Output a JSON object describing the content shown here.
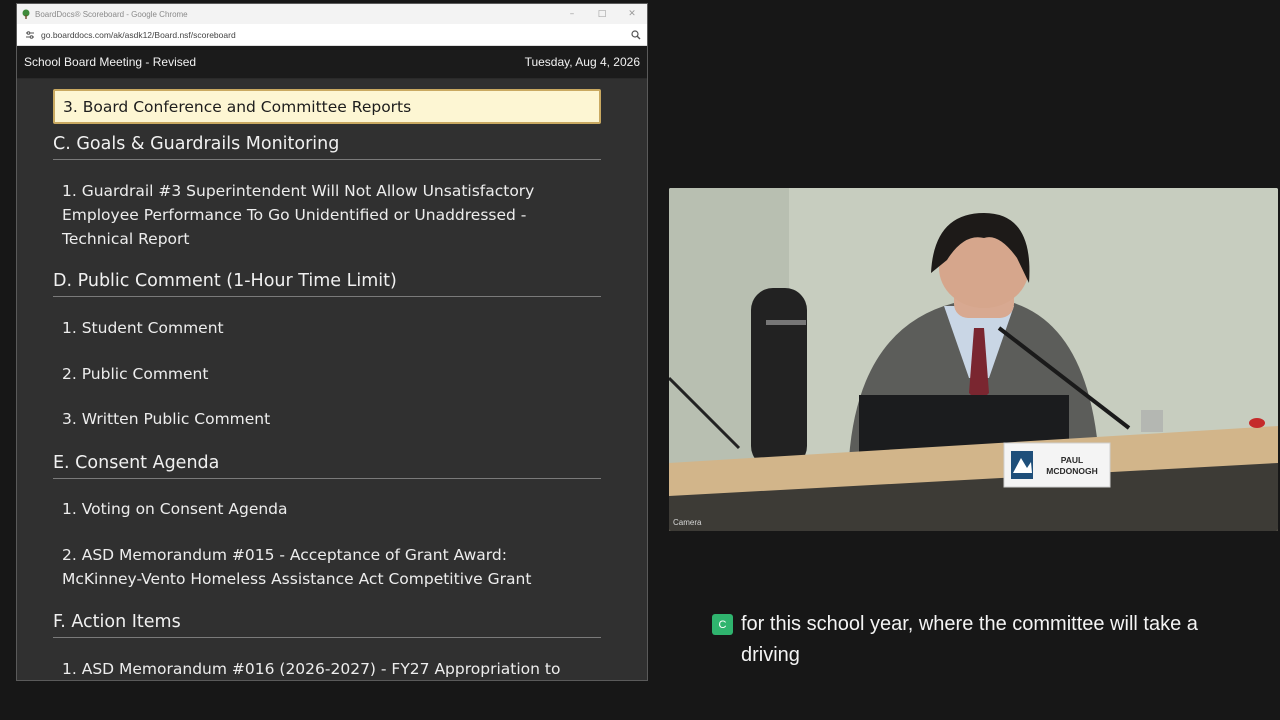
{
  "browser": {
    "window_title": "BoardDocs® Scoreboard - Google Chrome",
    "url": "go.boarddocs.com/ak/asdk12/Board.nsf/scoreboard",
    "controls": {
      "minimize": "–",
      "maximize": "□",
      "close": "✕"
    }
  },
  "header": {
    "meeting": "School Board Meeting - Revised",
    "date": "Tuesday, Aug 4, 2026"
  },
  "agenda": {
    "current_item": "3. Board Conference and Committee Reports",
    "section_c": "C. Goals & Guardrails Monitoring",
    "c_1": "1. Guardrail #3 Superintendent Will Not Allow Unsatisfactory Employee Performance To Go Unidentified or Unaddressed - Technical Report",
    "section_d": "D. Public Comment (1-Hour Time Limit)",
    "d_1": "1. Student Comment",
    "d_2": "2. Public Comment",
    "d_3": "3. Written Public Comment",
    "section_e": "E. Consent Agenda",
    "e_1": "1. Voting on Consent Agenda",
    "e_2": "2. ASD Memorandum #015 - Acceptance of Grant Award: McKinney-Vento Homeless Assistance Act Competitive Grant",
    "section_f": "F. Action Items",
    "f_1": "1. ASD Memorandum #016 (2026-2027) - FY27 Appropriation to"
  },
  "video": {
    "label": "Camera",
    "nameplate_first": "PAUL",
    "nameplate_last": "MCDONOGH"
  },
  "caption": {
    "badge": "C",
    "text": "for this school year, where the committee will take a driving"
  }
}
